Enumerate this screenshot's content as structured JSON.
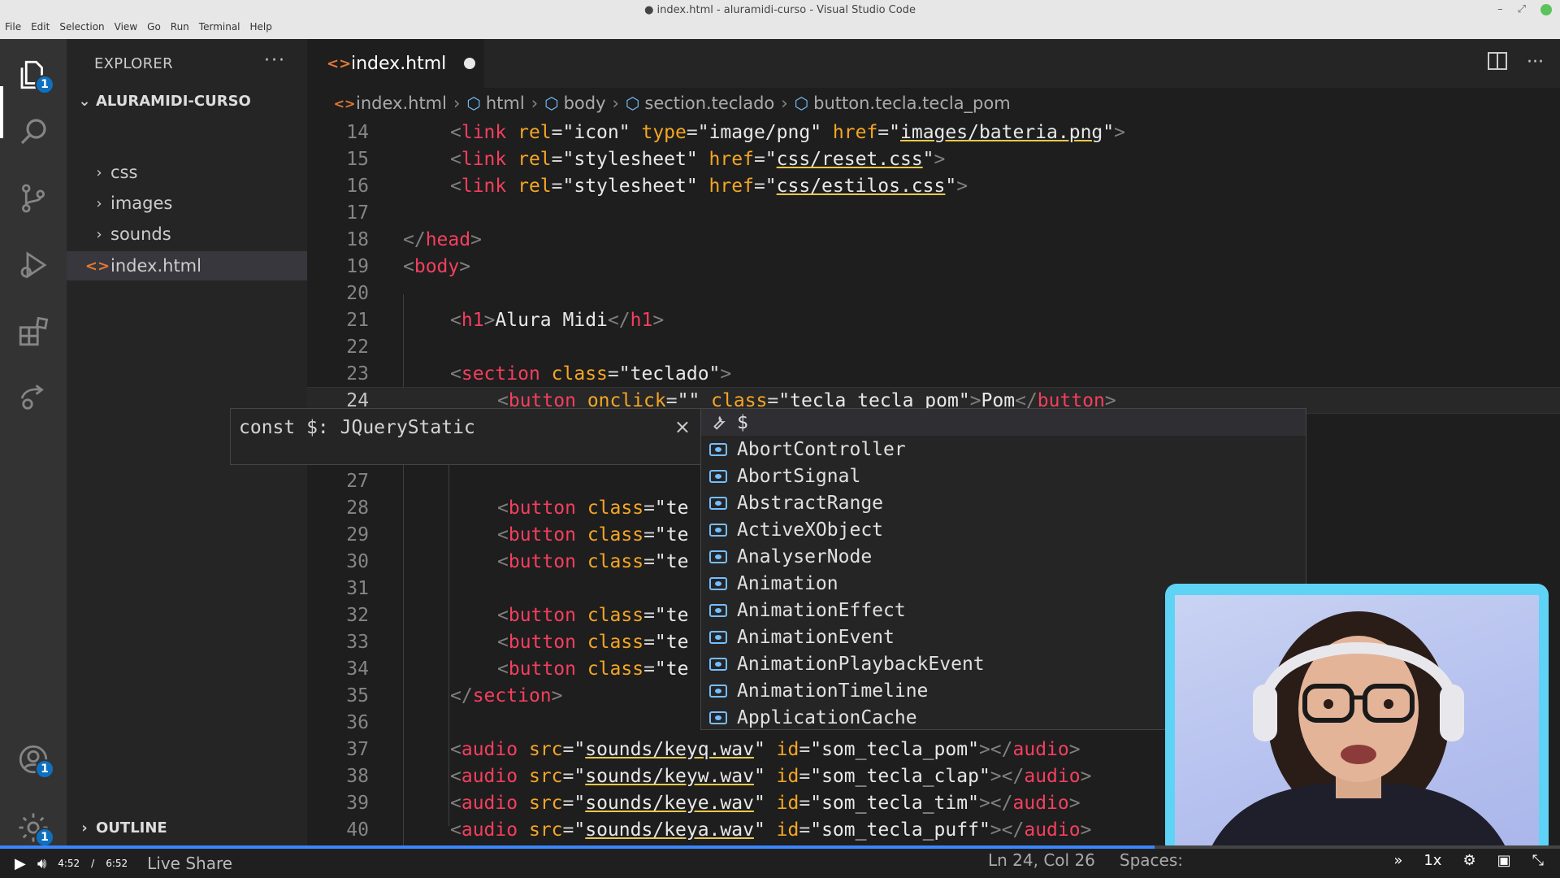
{
  "window": {
    "title": "● index.html - aluramidi-curso - Visual Studio Code",
    "menu": [
      "File",
      "Edit",
      "Selection",
      "View",
      "Go",
      "Run",
      "Terminal",
      "Help"
    ]
  },
  "activity_bar": {
    "explorer_badge": "1",
    "accounts_badge": "1",
    "settings_badge": "1"
  },
  "sidebar": {
    "title": "EXPLORER",
    "more": "···",
    "root": "ALURAMIDI-CURSO",
    "items": [
      {
        "label": "css",
        "type": "folder"
      },
      {
        "label": "images",
        "type": "folder"
      },
      {
        "label": "sounds",
        "type": "folder"
      },
      {
        "label": "index.html",
        "type": "file"
      }
    ],
    "outline": "OUTLINE"
  },
  "tab": {
    "label": "index.html",
    "icon": "<>"
  },
  "breadcrumb": {
    "file": "index.html",
    "html": "html",
    "body": "body",
    "section": "section.teclado",
    "button": "button.tecla.tecla_pom"
  },
  "editor": {
    "line_numbers": [
      "14",
      "15",
      "16",
      "17",
      "18",
      "19",
      "20",
      "21",
      "22",
      "23",
      "24",
      "27",
      "28",
      "29",
      "30",
      "31",
      "32",
      "33",
      "34",
      "35",
      "36",
      "37",
      "38",
      "39",
      "40"
    ]
  },
  "hover": {
    "text": "const $: JQueryStatic",
    "close": "×"
  },
  "suggest": {
    "query": "$",
    "items": [
      "AbortController",
      "AbortSignal",
      "AbstractRange",
      "ActiveXObject",
      "AnalyserNode",
      "Animation",
      "AnimationEffect",
      "AnimationEvent",
      "AnimationPlaybackEvent",
      "AnimationTimeline",
      "ApplicationCache"
    ]
  },
  "statusbar": {
    "time_current": "4:52",
    "time_sep": "/",
    "time_total": "6:52",
    "live_share": "Live Share",
    "cursor": "Ln 24, Col 26",
    "spaces": "Spaces:",
    "speed": "1x",
    "progress": 0.74
  },
  "colors": {
    "accent_blue": "#0e70c0",
    "tag": "#f43f5e",
    "attr": "#f5a623",
    "cam_border": "#5fd3f5"
  }
}
